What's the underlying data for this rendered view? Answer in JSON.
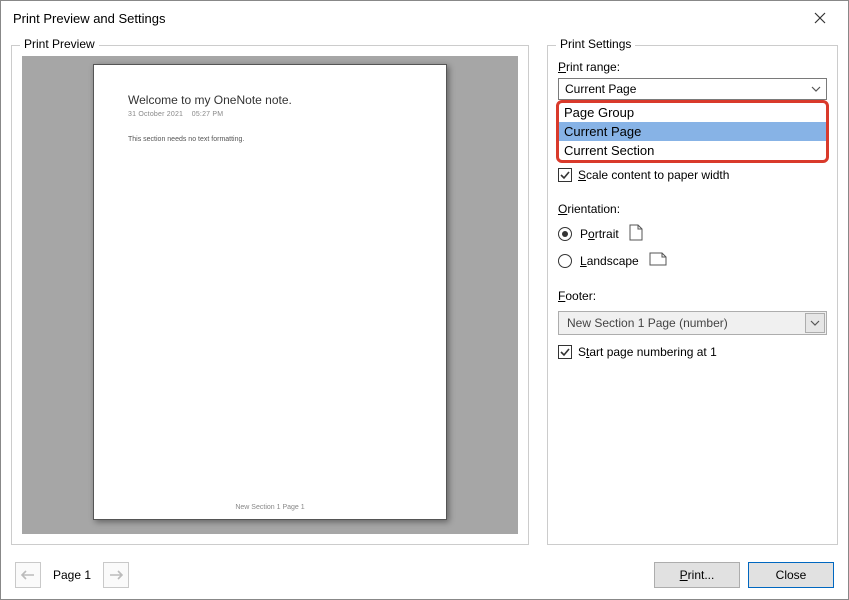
{
  "titlebar": {
    "title": "Print Preview and Settings"
  },
  "preview": {
    "group_label": "Print Preview",
    "page": {
      "title": "Welcome to my OneNote note.",
      "date": "31 October 2021",
      "time": "05:27 PM",
      "body_line": "This section needs no text formatting.",
      "footer": "New Section 1 Page 1"
    }
  },
  "settings": {
    "group_label": "Print Settings",
    "range_label": "Print range:",
    "range_value": "Current Page",
    "range_options": [
      "Page Group",
      "Current Page",
      "Current Section"
    ],
    "scale_label": "Scale content to paper width",
    "scale_checked": true,
    "orientation_label": "Orientation:",
    "radio_portrait": "Portrait",
    "radio_landscape": "Landscape",
    "orientation_value": "Portrait",
    "footer_label": "Footer:",
    "footer_value": "New Section 1 Page (number)",
    "startnum_label": "Start page numbering at 1",
    "startnum_checked": true
  },
  "nav": {
    "page_indicator": "Page 1"
  },
  "buttons": {
    "print": "Print...",
    "close": "Close"
  },
  "accel": {
    "P": "P",
    "r": "r",
    "S": "S",
    "O": "O",
    "o": "o",
    "L": "L",
    "F": "F",
    "t": "t"
  }
}
